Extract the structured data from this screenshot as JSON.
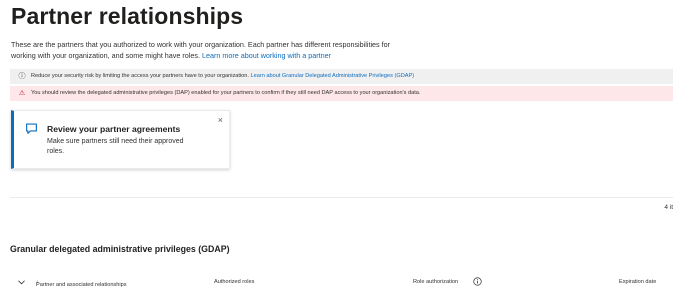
{
  "page": {
    "title": "Partner relationships",
    "description_line1": "These are the partners that you authorized to work with your organization. Each partner has different responsibilities for",
    "description_line2": "working with your organization, and some might have roles.",
    "description_link": "Learn more about working with a partner"
  },
  "info_bar": {
    "icon": "info-icon",
    "text": "Reduce your security risk by limiting the access your partners have to your organization.",
    "link": "Learn about Granular Delegated Administrative Privileges (GDAP)"
  },
  "warning_bar": {
    "icon": "warning-icon",
    "text": "You should review the delegated administrative privileges (DAP) enabled for your partners to confirm if they still need DAP access to your organization's data.",
    "color": "#fde7e9"
  },
  "card": {
    "icon": "chat-icon",
    "title": "Review your partner agreements",
    "body_line1": "Make sure partners still need their approved",
    "body_line2": "roles.",
    "close": "×"
  },
  "items_count": "4 it",
  "gdap": {
    "section_title": "Granular delegated administrative privileges (GDAP)",
    "columns": {
      "partner": "Partner and associated relationships",
      "partner_sort": "↓",
      "roles": "Authorized roles",
      "authorization": "Role authorization",
      "expiration": "Expiration date"
    }
  },
  "colors": {
    "accent": "#0f6cbd",
    "warning": "#c50f1f",
    "info_bg": "#f0f0f0"
  }
}
